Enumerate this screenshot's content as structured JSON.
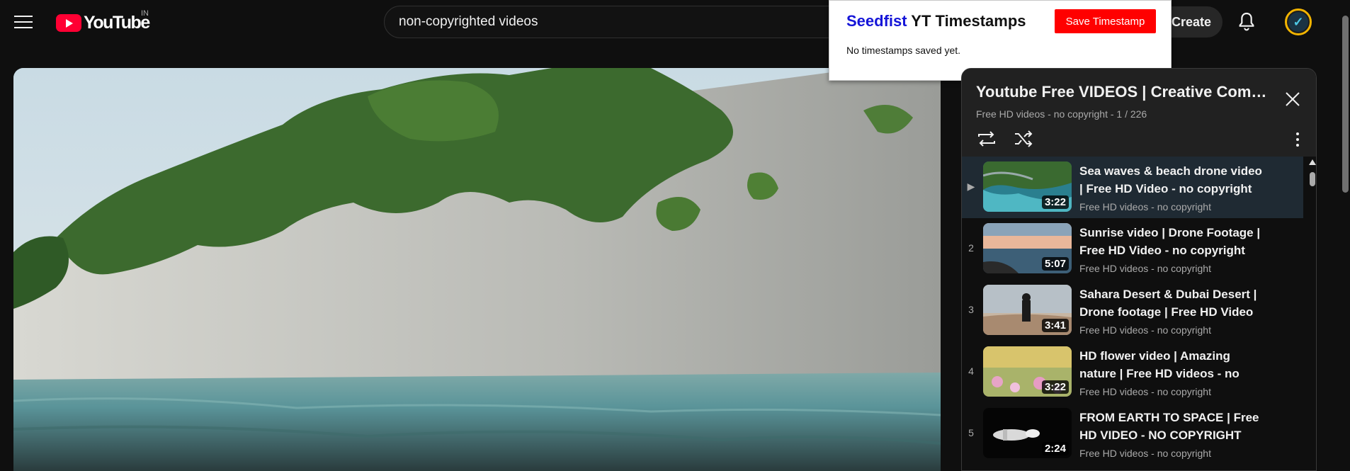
{
  "header": {
    "logo_text": "YouTube",
    "country_code": "IN",
    "search_value": "non-copyrighted videos",
    "create_label": "Create"
  },
  "extension": {
    "brand": "Seedfist",
    "title_rest": " YT Timestamps",
    "save_label": "Save Timestamp",
    "empty_text": "No timestamps saved yet."
  },
  "playlist": {
    "title": "Youtube Free VIDEOS | Creative Commons",
    "subtitle": "Free HD videos - no copyright - 1 / 226",
    "items": [
      {
        "index": "▶",
        "title": "Sea waves & beach drone video | Free HD Video - no copyright",
        "channel": "Free HD videos - no copyright",
        "duration": "3:22"
      },
      {
        "index": "2",
        "title": "Sunrise video | Drone Footage | Free HD Video - no copyright",
        "channel": "Free HD videos - no copyright",
        "duration": "5:07"
      },
      {
        "index": "3",
        "title": "Sahara Desert & Dubai Desert | Drone footage | Free HD Video",
        "channel": "Free HD videos - no copyright",
        "duration": "3:41"
      },
      {
        "index": "4",
        "title": "HD flower video | Amazing nature | Free HD videos - no copyright",
        "channel": "Free HD videos - no copyright",
        "duration": "3:22"
      },
      {
        "index": "5",
        "title": "FROM EARTH TO SPACE | Free HD VIDEO - NO COPYRIGHT",
        "channel": "Free HD videos - no copyright",
        "duration": "2:24"
      }
    ]
  },
  "colors": {
    "brand_red": "#ff0033",
    "save_red": "#ff0000",
    "ext_brand_blue": "#1515d8",
    "avatar_ring": "#f2b400"
  }
}
